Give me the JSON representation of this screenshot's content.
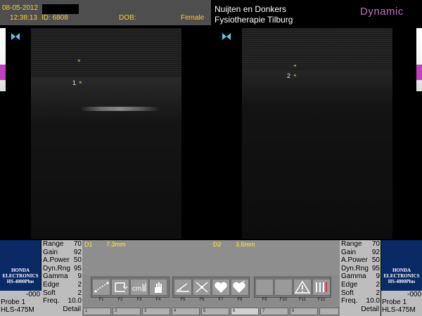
{
  "header": {
    "date": "08-05-2012",
    "time": "12:38:13",
    "patient_id": "ID: 6808",
    "dob_label": "DOB:",
    "sex": "Female",
    "clinic_line1": "Nuijten en Donkers",
    "clinic_line2": "Fysiotherapie Tilburg",
    "brand": "Dynamic"
  },
  "calipers": [
    {
      "label": "1",
      "marker": "×"
    },
    {
      "label": "2",
      "marker": "+"
    }
  ],
  "measurements": {
    "d1_label": "D1",
    "d1_value": "7.3mm",
    "d2_label": "D2",
    "d2_value": "3.6mm"
  },
  "params_left": {
    "rows": [
      {
        "name": "Range",
        "value": "70"
      },
      {
        "name": "Gain",
        "value": "92"
      },
      {
        "name": "A.Power",
        "value": "50"
      },
      {
        "name": "Dyn.Rng",
        "value": "95"
      },
      {
        "name": "Gamma",
        "value": "9"
      },
      {
        "name": "Edge",
        "value": "2"
      },
      {
        "name": "Soft",
        "value": "2"
      },
      {
        "name": "Freq.",
        "value": "10.0"
      }
    ],
    "mode": "Detail"
  },
  "params_right": {
    "rows": [
      {
        "name": "Range",
        "value": "70"
      },
      {
        "name": "Gain",
        "value": "92"
      },
      {
        "name": "A.Power",
        "value": "50"
      },
      {
        "name": "Dyn.Rng",
        "value": "95"
      },
      {
        "name": "Gamma",
        "value": "9"
      },
      {
        "name": "Edge",
        "value": "2"
      },
      {
        "name": "Soft",
        "value": "2"
      },
      {
        "name": "Freq.",
        "value": "10.0"
      }
    ],
    "mode": "Detail"
  },
  "probe_left": {
    "maker1": "HONDA",
    "maker2": "ELECTRONICS",
    "model": "HS-4000Plus",
    "offset": "-000",
    "probe": "Probe 1",
    "probe_model": "HLS-475M"
  },
  "probe_right": {
    "maker1": "HONDA",
    "maker2": "ELECTRONICS",
    "model": "HS-4000Plus",
    "offset": "-000",
    "probe": "Probe 1",
    "probe_model": "HLS-475M"
  },
  "fkeys": [
    "F1",
    "F2",
    "F3",
    "F4",
    "F5",
    "F6",
    "F7",
    "F8",
    "F9",
    "F10",
    "F11",
    "F12"
  ],
  "tabs": [
    "1",
    "2",
    "3",
    "4",
    "5",
    "6",
    "7",
    "8"
  ],
  "colors": {
    "header_text": "#ffcc33",
    "brand": "#c070c0",
    "panel_blue": "#0a2a66",
    "measure_text": "#ffee33"
  }
}
